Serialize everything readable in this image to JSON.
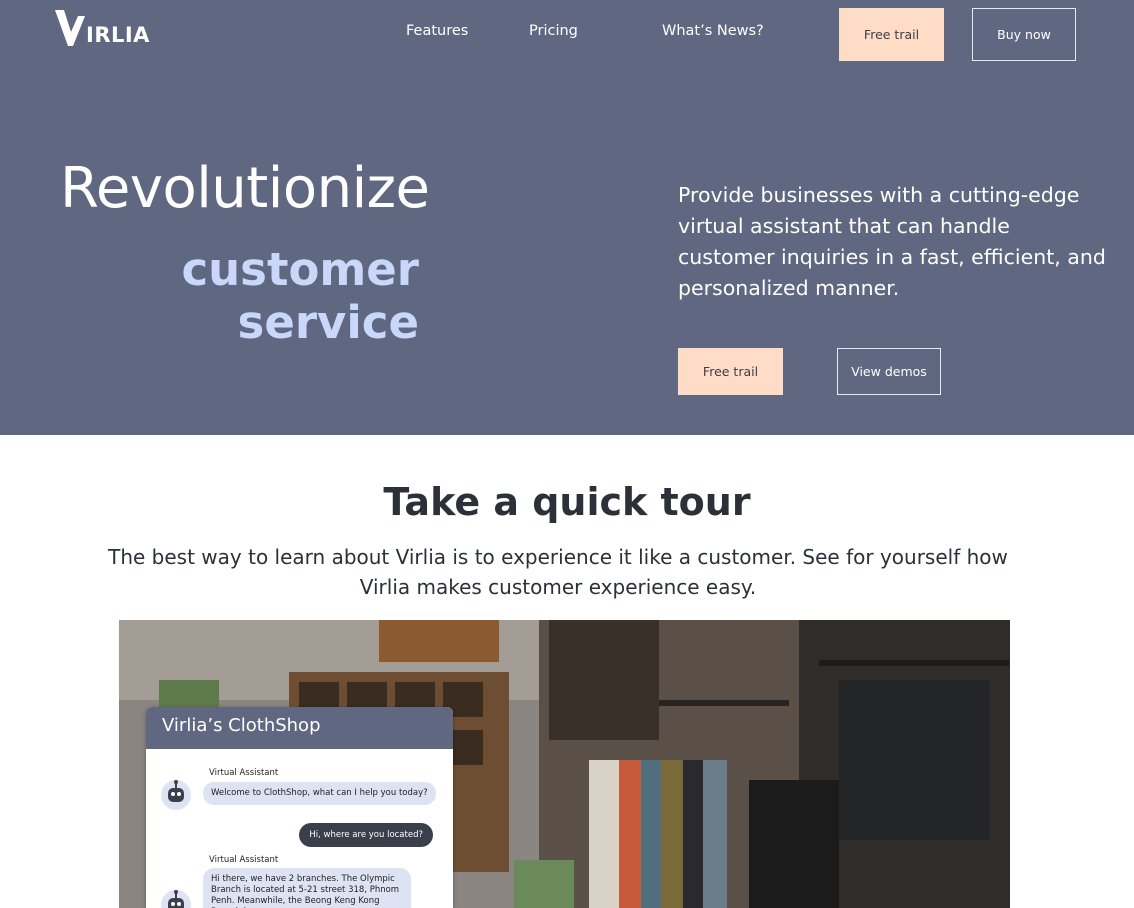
{
  "brand": {
    "name": "IRLIA",
    "mark": "V"
  },
  "nav": {
    "links": [
      "Features",
      "Pricing",
      "What’s News?"
    ],
    "free_trial": "Free trail",
    "buy_now": "Buy now"
  },
  "hero": {
    "headline_1": "Revolutionize",
    "headline_2": "customer",
    "headline_3": "service",
    "description": "Provide businesses with a cutting-edge virtual assistant that can handle customer inquiries in a fast, efficient, and personalized manner.",
    "cta_primary": "Free trail",
    "cta_secondary": "View demos"
  },
  "tour": {
    "title": "Take a quick tour",
    "subtitle": "The best way to learn about Virlia is to experience it like a customer. See for yourself how Virlia makes customer experience easy."
  },
  "chat": {
    "title": "Virlia’s ClothShop",
    "messages": [
      {
        "from": "bot",
        "sender": "Virtual Assistant",
        "text": "Welcome to ClothShop, what can I help you today?"
      },
      {
        "from": "user",
        "text": "Hi, where are you located?"
      },
      {
        "from": "bot",
        "sender": "Virtual Assistant",
        "text": "Hi there, we have 2 branches. The Olympic Branch is located at 5-21 street 318, Phnom Penh. Meanwhile, the Beong Keng Kong Branch is"
      }
    ]
  },
  "colors": {
    "hero_bg": "#5f6880",
    "accent_peach": "#fedcc6",
    "accent_lavender": "#c9d7fb",
    "text_dark": "#2c3038"
  }
}
